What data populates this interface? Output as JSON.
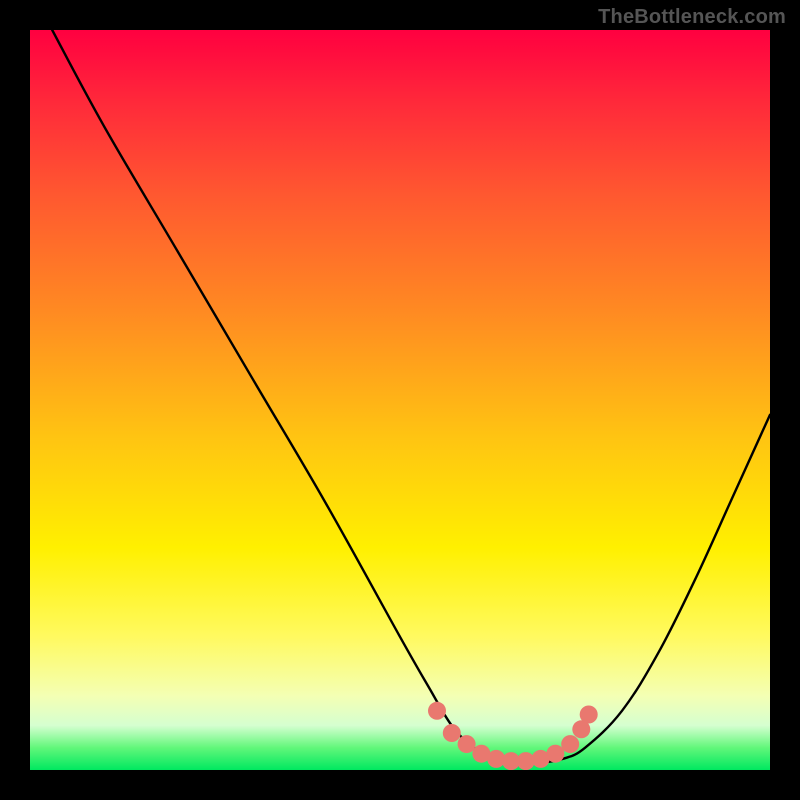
{
  "watermark": "TheBottleneck.com",
  "colors": {
    "frame": "#000000",
    "curve": "#000000",
    "marker": "#e9786f",
    "gradient_top": "#ff0040",
    "gradient_mid": "#fff000",
    "gradient_bottom": "#00e860"
  },
  "chart_data": {
    "type": "line",
    "title": "",
    "xlabel": "",
    "ylabel": "",
    "xlim": [
      0,
      100
    ],
    "ylim": [
      0,
      100
    ],
    "grid": false,
    "legend": false,
    "series": [
      {
        "name": "bottleneck-curve",
        "x": [
          3,
          10,
          20,
          30,
          40,
          50,
          54,
          57,
          60,
          63,
          66,
          69,
          72,
          75,
          80,
          85,
          90,
          95,
          100
        ],
        "y": [
          100,
          87,
          70,
          53,
          36,
          18,
          11,
          6,
          3,
          1.5,
          1,
          1,
          1.5,
          3,
          8,
          16,
          26,
          37,
          48
        ]
      }
    ],
    "markers": {
      "name": "highlight-range",
      "x": [
        55,
        57,
        59,
        61,
        63,
        65,
        67,
        69,
        71,
        73,
        74.5,
        75.5
      ],
      "y": [
        8,
        5,
        3.5,
        2.2,
        1.5,
        1.2,
        1.2,
        1.5,
        2.2,
        3.5,
        5.5,
        7.5
      ]
    }
  }
}
